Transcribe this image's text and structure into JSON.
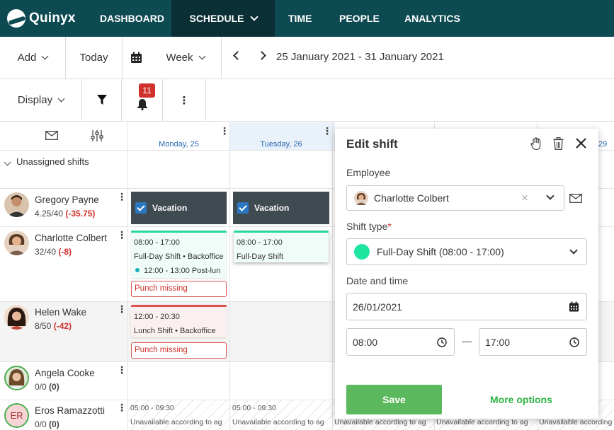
{
  "nav": {
    "brand": "Quinyx",
    "items": [
      "DASHBOARD",
      "SCHEDULE",
      "TIME",
      "PEOPLE",
      "ANALYTICS"
    ]
  },
  "toolbar": {
    "add": "Add",
    "today": "Today",
    "week": "Week",
    "date_range": "25 January 2021 - 31 January 2021",
    "display": "Display",
    "notification_count": "11"
  },
  "grid": {
    "days": [
      "Monday, 25",
      "Tuesday, 26",
      "29"
    ],
    "unassigned_label": "Unassigned shifts"
  },
  "employees": [
    {
      "name": "Gregory Payne",
      "hours": "4.25/40",
      "diff": "(-35.75)"
    },
    {
      "name": "Charlotte Colbert",
      "hours": "32/40",
      "diff": "(-8)"
    },
    {
      "name": "Helen Wake",
      "hours": "8/50",
      "diff": "(-42)"
    },
    {
      "name": "Angela Cooke",
      "hours": "0/0",
      "diff": "(0)"
    },
    {
      "name": "Eros Ramazzotti",
      "hours": "0/0",
      "diff": "(0)",
      "initials": "ER"
    }
  ],
  "shifts": {
    "vacation_label": "Vacation",
    "charlotte_mon": {
      "time": "08:00 - 17:00",
      "type": "Full-Day Shift • Backoffice",
      "sub": "12:00 - 13:00 Post-lun"
    },
    "charlotte_tue": {
      "time": "08:00 - 17:00",
      "type": "Full-Day Shift"
    },
    "helen_mon": {
      "time": "12:00 - 20:30",
      "type": "Lunch Shift • Backoffice"
    },
    "punch_missing": "Punch missing",
    "eros_time": "05:00 - 09:30",
    "unavailable_text": "Unavailable according to ag"
  },
  "edit_shift": {
    "title": "Edit shift",
    "employee_label": "Employee",
    "employee_value": "Charlotte Colbert",
    "shift_type_label": "Shift type",
    "required_mark": "*",
    "shift_type_value": "Full-Day Shift  (08:00 - 17:00)",
    "date_time_label": "Date and time",
    "date_value": "26/01/2021",
    "start_time": "08:00",
    "end_time": "17:00",
    "dash": "—",
    "save": "Save",
    "more_options": "More options",
    "colors": {
      "save": "#5cb85c",
      "shift_dot": "#1ee6a0",
      "more_options": "#2fb344"
    }
  }
}
